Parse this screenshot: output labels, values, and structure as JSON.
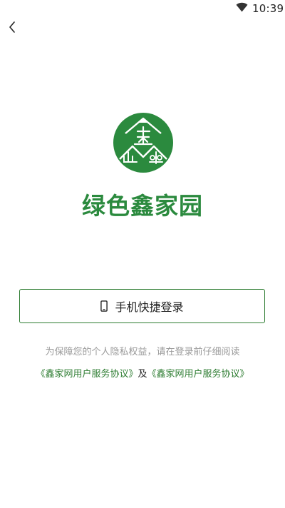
{
  "status_bar": {
    "time": "10:39",
    "wifi_icon": "wifi-icon"
  },
  "header": {
    "back_icon": "chevron-left-icon"
  },
  "brand": {
    "logo_icon": "green-xin-logo-icon",
    "name": "绿色鑫家园",
    "color": "#2b8a3e"
  },
  "login": {
    "button_label": "手机快捷登录",
    "icon": "phone-icon",
    "border_color": "#2e7d32"
  },
  "notice": {
    "text": "为保障您的个人隐私权益，请在登录前仔细阅读"
  },
  "agreements": {
    "first": "《鑫家网用户服务协议》",
    "connector": "及",
    "second": "《鑫家网用户服务协议》",
    "link_color": "#2e7d32"
  }
}
